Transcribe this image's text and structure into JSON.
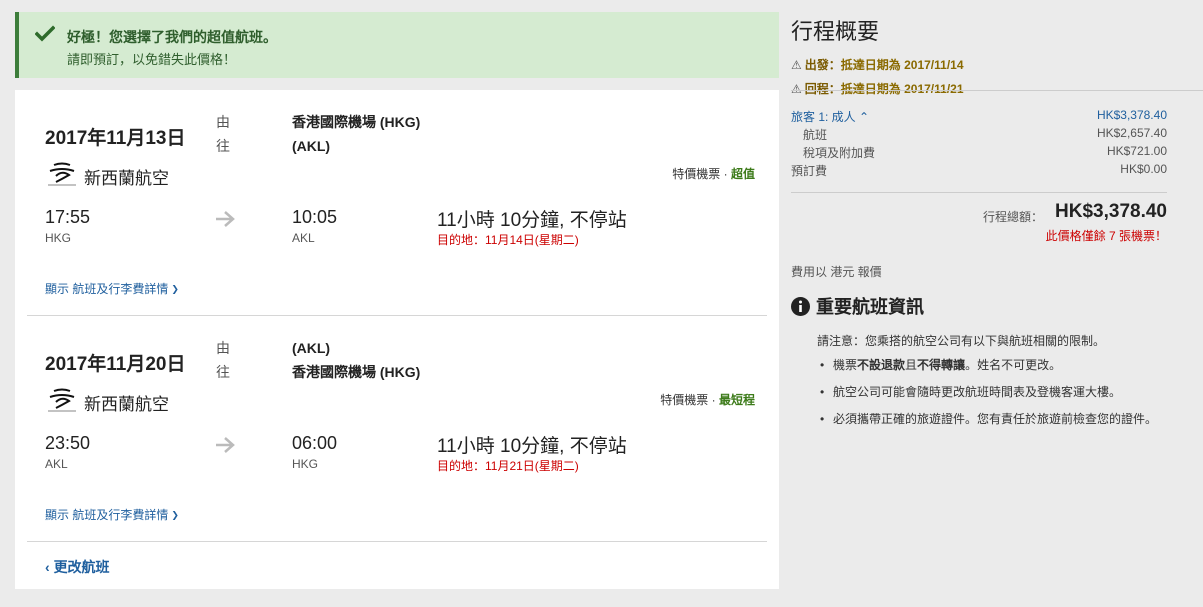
{
  "alert": {
    "title": "好極！您選擇了我們的超值航班。",
    "subtitle": "請即預訂，以免錯失此價格！"
  },
  "legs": [
    {
      "date": "2017年11月13日",
      "from_label": "由",
      "to_label": "往",
      "from_airport": "香港國際機場 (HKG)",
      "to_airport": "(AKL)",
      "airline": "新西蘭航空",
      "fare_type": "特價機票",
      "fare_tag": "超值",
      "dep_time": "17:55",
      "dep_code": "HKG",
      "arr_time": "10:05",
      "arr_code": "AKL",
      "duration": "11小時 10分鐘, 不停站",
      "destination": "目的地：11月14日(星期二)",
      "details_link": "顯示 航班及行李費詳情"
    },
    {
      "date": "2017年11月20日",
      "from_label": "由",
      "to_label": "往",
      "from_airport": "(AKL)",
      "to_airport": "香港國際機場 (HKG)",
      "airline": "新西蘭航空",
      "fare_type": "特價機票",
      "fare_tag": "最短程",
      "dep_time": "23:50",
      "dep_code": "AKL",
      "arr_time": "06:00",
      "arr_code": "HKG",
      "duration": "11小時 10分鐘, 不停站",
      "destination": "目的地：11月21日(星期二)",
      "details_link": "顯示 航班及行李費詳情"
    }
  ],
  "change_flight": "更改航班",
  "summary": {
    "title": "行程概要",
    "outbound_label": "出發：",
    "outbound_text": "抵達日期為 2017/11/14",
    "return_label": "回程：",
    "return_text": "抵達日期為 2017/11/21",
    "traveler_label": "旅客 1: 成人",
    "traveler_value": "HK$3,378.40",
    "flight_label": "航班",
    "flight_value": "HK$2,657.40",
    "tax_label": "稅項及附加費",
    "tax_value": "HK$721.00",
    "booking_label": "預訂費",
    "booking_value": "HK$0.00",
    "total_label": "行程總額：",
    "total_value": "HK$3,378.40",
    "seats_left": "此價格僅餘 7 張機票！",
    "currency_note": "費用以 港元 報價"
  },
  "info": {
    "title": "重要航班資訊",
    "notice": "請注意：您乘搭的航空公司有以下與航班相關的限制。",
    "b1_part1": "機票",
    "b1_bold1": "不設退款",
    "b1_part2": "且",
    "b1_bold2": "不得轉讓",
    "b1_part3": "。姓名不可更改。",
    "b2": "航空公司可能會隨時更改航班時間表及登機客運大樓。",
    "b3": "必須攜帶正確的旅遊證件。您有責任於旅遊前檢查您的證件。"
  },
  "colors": {
    "alert_bg": "#d5ebd1",
    "link": "#1f5f9e",
    "warning": "#c00000",
    "good": "#3d7b1a"
  },
  "icons": {
    "alert": "check-icon",
    "leg_arrow": "arrow-right-icon",
    "warning": "warning-triangle-icon",
    "info": "info-circle-icon"
  }
}
